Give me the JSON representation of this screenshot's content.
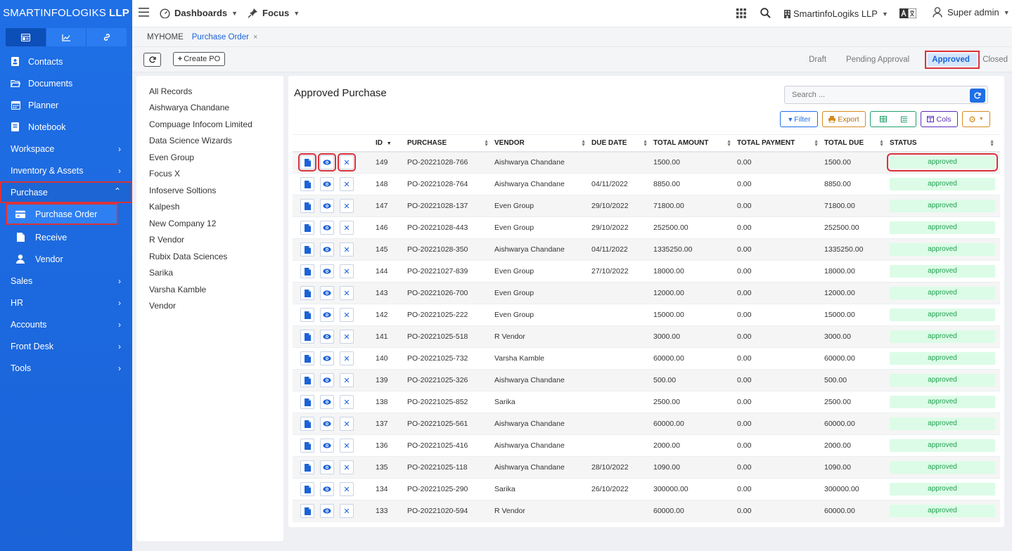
{
  "brand": {
    "light": "SMARTINFOLOGIKS",
    "bold": "LLP"
  },
  "sidebar": {
    "tabs": [
      "layout-icon",
      "chart-icon",
      "link-icon"
    ],
    "top_items": [
      {
        "label": "Contacts",
        "icon": "contact-icon"
      },
      {
        "label": "Documents",
        "icon": "folder-icon"
      },
      {
        "label": "Planner",
        "icon": "calendar-icon"
      },
      {
        "label": "Notebook",
        "icon": "notebook-icon"
      }
    ],
    "groups": {
      "workspace": "Workspace",
      "inventory": "Inventory & Assets",
      "purchase": "Purchase",
      "sales": "Sales",
      "hr": "HR",
      "accounts": "Accounts",
      "frontdesk": "Front Desk",
      "tools": "Tools"
    },
    "purchase_sub": {
      "purchase_order": "Purchase Order",
      "receive": "Receive",
      "vendor": "Vendor"
    }
  },
  "topbar": {
    "dashboards": "Dashboards",
    "focus": "Focus",
    "company": "SmartinfoLogiks LLP",
    "user": "Super admin"
  },
  "breadcrumb": {
    "home": "MYHOME",
    "current": "Purchase Order",
    "close": "×"
  },
  "actions": {
    "create_po": "Create PO"
  },
  "status_tabs": {
    "draft": "Draft",
    "pending": "Pending Approval",
    "approved": "Approved",
    "closed": "Closed"
  },
  "left_list": [
    "All Records",
    "Aishwarya Chandane",
    "Compuage Infocom Limited",
    "Data Science Wizards",
    "Even Group",
    "Focus X",
    "Infoserve Soltions",
    "Kalpesh",
    "New Company 12",
    "R Vendor",
    "Rubix Data Sciences",
    "Sarika",
    "Varsha Kamble",
    "Vendor"
  ],
  "main": {
    "title": "Approved Purchase",
    "search_placeholder": "Search ...",
    "tools": {
      "filter": "Filter",
      "export": "Export",
      "cols": "Cols"
    },
    "columns": {
      "id": "ID",
      "purchase": "PURCHASE",
      "vendor": "VENDOR",
      "due_date": "DUE DATE",
      "total_amount": "TOTAL AMOUNT",
      "total_payment": "TOTAL PAYMENT",
      "total_due": "TOTAL DUE",
      "status": "STATUS"
    },
    "rows": [
      {
        "id": "149",
        "purchase": "PO-20221028-766",
        "vendor": "Aishwarya Chandane",
        "due": "",
        "amount": "1500.00",
        "payment": "0.00",
        "total_due": "1500.00",
        "status": "approved"
      },
      {
        "id": "148",
        "purchase": "PO-20221028-764",
        "vendor": "Aishwarya Chandane",
        "due": "04/11/2022",
        "amount": "8850.00",
        "payment": "0.00",
        "total_due": "8850.00",
        "status": "approved"
      },
      {
        "id": "147",
        "purchase": "PO-20221028-137",
        "vendor": "Even Group",
        "due": "29/10/2022",
        "amount": "71800.00",
        "payment": "0.00",
        "total_due": "71800.00",
        "status": "approved"
      },
      {
        "id": "146",
        "purchase": "PO-20221028-443",
        "vendor": "Even Group",
        "due": "29/10/2022",
        "amount": "252500.00",
        "payment": "0.00",
        "total_due": "252500.00",
        "status": "approved"
      },
      {
        "id": "145",
        "purchase": "PO-20221028-350",
        "vendor": "Aishwarya Chandane",
        "due": "04/11/2022",
        "amount": "1335250.00",
        "payment": "0.00",
        "total_due": "1335250.00",
        "status": "approved"
      },
      {
        "id": "144",
        "purchase": "PO-20221027-839",
        "vendor": "Even Group",
        "due": "27/10/2022",
        "amount": "18000.00",
        "payment": "0.00",
        "total_due": "18000.00",
        "status": "approved"
      },
      {
        "id": "143",
        "purchase": "PO-20221026-700",
        "vendor": "Even Group",
        "due": "",
        "amount": "12000.00",
        "payment": "0.00",
        "total_due": "12000.00",
        "status": "approved"
      },
      {
        "id": "142",
        "purchase": "PO-20221025-222",
        "vendor": "Even Group",
        "due": "",
        "amount": "15000.00",
        "payment": "0.00",
        "total_due": "15000.00",
        "status": "approved"
      },
      {
        "id": "141",
        "purchase": "PO-20221025-518",
        "vendor": "R Vendor",
        "due": "",
        "amount": "3000.00",
        "payment": "0.00",
        "total_due": "3000.00",
        "status": "approved"
      },
      {
        "id": "140",
        "purchase": "PO-20221025-732",
        "vendor": "Varsha Kamble",
        "due": "",
        "amount": "60000.00",
        "payment": "0.00",
        "total_due": "60000.00",
        "status": "approved"
      },
      {
        "id": "139",
        "purchase": "PO-20221025-326",
        "vendor": "Aishwarya Chandane",
        "due": "",
        "amount": "500.00",
        "payment": "0.00",
        "total_due": "500.00",
        "status": "approved"
      },
      {
        "id": "138",
        "purchase": "PO-20221025-852",
        "vendor": "Sarika",
        "due": "",
        "amount": "2500.00",
        "payment": "0.00",
        "total_due": "2500.00",
        "status": "approved"
      },
      {
        "id": "137",
        "purchase": "PO-20221025-561",
        "vendor": "Aishwarya Chandane",
        "due": "",
        "amount": "60000.00",
        "payment": "0.00",
        "total_due": "60000.00",
        "status": "approved"
      },
      {
        "id": "136",
        "purchase": "PO-20221025-416",
        "vendor": "Aishwarya Chandane",
        "due": "",
        "amount": "2000.00",
        "payment": "0.00",
        "total_due": "2000.00",
        "status": "approved"
      },
      {
        "id": "135",
        "purchase": "PO-20221025-118",
        "vendor": "Aishwarya Chandane",
        "due": "28/10/2022",
        "amount": "1090.00",
        "payment": "0.00",
        "total_due": "1090.00",
        "status": "approved"
      },
      {
        "id": "134",
        "purchase": "PO-20221025-290",
        "vendor": "Sarika",
        "due": "26/10/2022",
        "amount": "300000.00",
        "payment": "0.00",
        "total_due": "300000.00",
        "status": "approved"
      },
      {
        "id": "133",
        "purchase": "PO-20221020-594",
        "vendor": "R Vendor",
        "due": "",
        "amount": "60000.00",
        "payment": "0.00",
        "total_due": "60000.00",
        "status": "approved"
      }
    ]
  },
  "colors": {
    "primary": "#1f6fe6",
    "highlight": "#d9333a",
    "approved_bg": "#dcfce7",
    "approved_text": "#22a04f"
  }
}
